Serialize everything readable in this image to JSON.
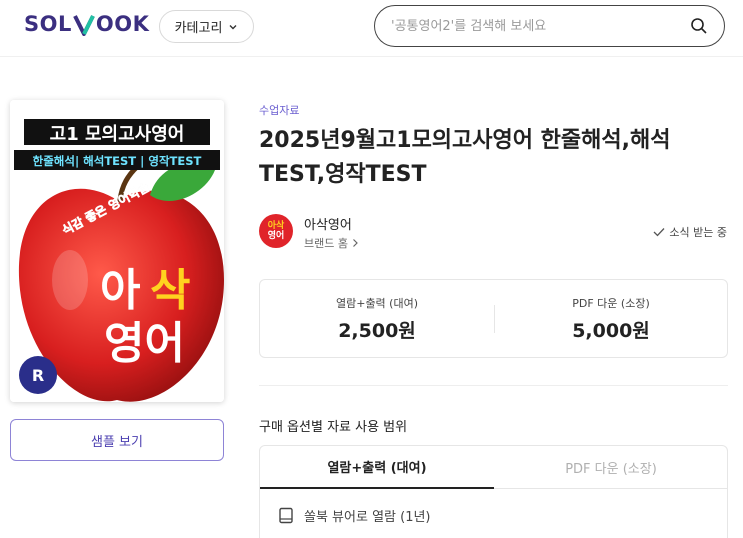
{
  "header": {
    "logo_left": "SOL",
    "logo_right": "OOK",
    "category_label": "카테고리",
    "search_placeholder": "'공통영어2'를 검색해 보세요"
  },
  "cover": {
    "line1": "고1 모의고사영어",
    "line2": "한줄해석| 해석TEST | 영작TEST",
    "slogan": "식감 좋은 영어학습",
    "brand_line1_a": "아",
    "brand_line1_b": "삭",
    "brand_line2": "영어",
    "badge_letter": "R"
  },
  "sample_button": "샘플 보기",
  "product": {
    "category": "수업자료",
    "title": "2025년9월고1모의고사영어 한줄해석,해석TEST,영작TEST"
  },
  "brand": {
    "logo_line1": "아삭",
    "logo_line2": "영어",
    "name": "아삭영어",
    "home_link": "브랜드 홈",
    "subscribe": "소식 받는 중"
  },
  "prices": [
    {
      "label": "열람+출력 (대여)",
      "value": "2,500원"
    },
    {
      "label": "PDF 다운 (소장)",
      "value": "5,000원"
    }
  ],
  "usage": {
    "title": "구매 옵션별 자료 사용 범위",
    "tabs": [
      "열람+출력 (대여)",
      "PDF 다운 (소장)"
    ],
    "row1": "쏠북 뷰어로 열람 (1년)"
  },
  "colors": {
    "brand": "#3b2f80",
    "accent": "#6b5fd0",
    "apple_red": "#e0242a"
  }
}
